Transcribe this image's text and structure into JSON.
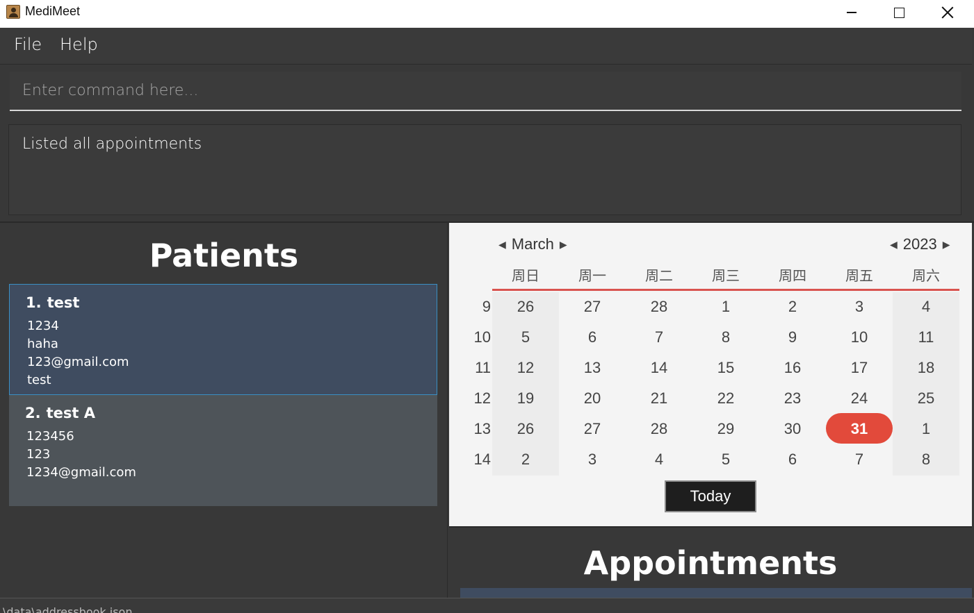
{
  "window": {
    "title": "MediMeet",
    "icons": {
      "app": "user-folder-icon",
      "minimize": "minimize-icon",
      "maximize": "maximize-icon",
      "close": "close-icon"
    }
  },
  "menu": {
    "file": "File",
    "help": "Help"
  },
  "command": {
    "placeholder": "Enter command here...",
    "value": ""
  },
  "result": {
    "text": "Listed all appointments"
  },
  "patients": {
    "title": "Patients",
    "items": [
      {
        "index": "1.",
        "name": "test",
        "phone": "1234",
        "address": "haha",
        "email": "123@gmail.com",
        "extra": "test"
      },
      {
        "index": "2.",
        "name": "test A",
        "phone": "123456",
        "address": "123",
        "email": "1234@gmail.com"
      }
    ]
  },
  "calendar": {
    "month": "March",
    "year": "2023",
    "weekday_headers": [
      "周日",
      "周一",
      "周二",
      "周三",
      "周四",
      "周五",
      "周六"
    ],
    "weeks": [
      {
        "number": "9",
        "days": [
          "26",
          "27",
          "28",
          "1",
          "2",
          "3",
          "4"
        ]
      },
      {
        "number": "10",
        "days": [
          "5",
          "6",
          "7",
          "8",
          "9",
          "10",
          "11"
        ]
      },
      {
        "number": "11",
        "days": [
          "12",
          "13",
          "14",
          "15",
          "16",
          "17",
          "18"
        ]
      },
      {
        "number": "12",
        "days": [
          "19",
          "20",
          "21",
          "22",
          "23",
          "24",
          "25"
        ]
      },
      {
        "number": "13",
        "days": [
          "26",
          "27",
          "28",
          "29",
          "30",
          "31",
          "1"
        ]
      },
      {
        "number": "14",
        "days": [
          "2",
          "3",
          "4",
          "5",
          "6",
          "7",
          "8"
        ]
      }
    ],
    "today": "31",
    "today_button": "Today",
    "colors": {
      "accent": "#e24a3b",
      "rule": "#d9534f"
    }
  },
  "appointments": {
    "title": "Appointments"
  },
  "status": {
    "text": "\\data\\addressbook.json"
  }
}
